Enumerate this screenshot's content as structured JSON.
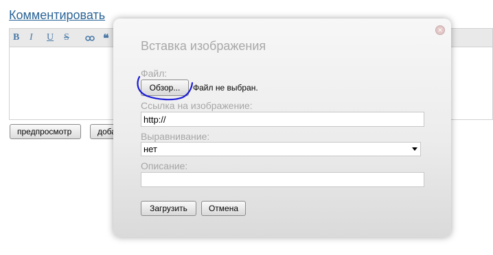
{
  "page": {
    "comment_link": "Комментировать",
    "toolbar": {
      "bold": "B",
      "italic": "I",
      "underline": "U",
      "strike": "S",
      "link_icon": "link-icon",
      "quote_icon": "quote-icon"
    },
    "buttons": {
      "preview": "предпросмотр",
      "add_partial": "доба"
    }
  },
  "modal": {
    "title": "Вставка изображения",
    "file_label": "Файл:",
    "browse_button": "Обзор...",
    "file_status": "Файл не выбран.",
    "image_link_label": "Ссылка на изображение:",
    "image_link_value": "http://",
    "alignment_label": "Выравнивание:",
    "alignment_value": "нет",
    "description_label": "Описание:",
    "description_value": "",
    "upload_button": "Загрузить",
    "cancel_button": "Отмена",
    "close_icon": "close-icon"
  },
  "colors": {
    "link": "#2a6496",
    "modal_label": "#a6a6a6",
    "annotation_stroke": "#1a1ad6"
  }
}
